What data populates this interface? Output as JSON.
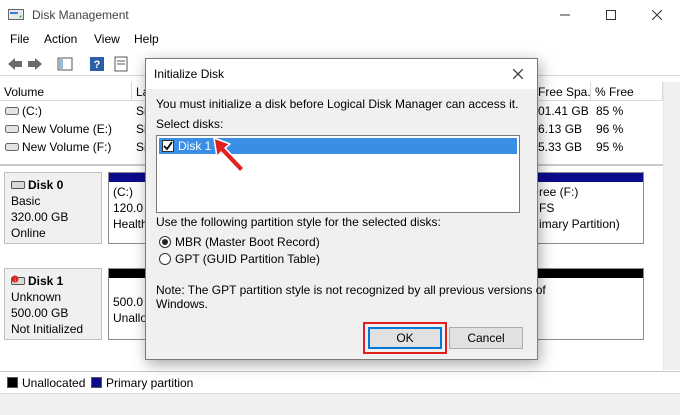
{
  "window": {
    "title": "Disk Management",
    "menus": [
      "File",
      "Action",
      "View",
      "Help"
    ]
  },
  "volume_list": {
    "columns": [
      "Volume",
      "La",
      "Free Spa...",
      "% Free"
    ],
    "rows": [
      {
        "name": "(C:)",
        "type_fragment": "Si",
        "free": "01.41 GB",
        "pct": "85 %"
      },
      {
        "name": "New Volume (E:)",
        "type_fragment": "Si",
        "free": "6.13 GB",
        "pct": "96 %"
      },
      {
        "name": "New Volume (F:)",
        "type_fragment": "Si",
        "free": "5.33 GB",
        "pct": "95 %"
      }
    ]
  },
  "disks": [
    {
      "name": "Disk 0",
      "lines": [
        "Basic",
        "320.00 GB",
        "Online"
      ],
      "part1": [
        "(C:)",
        "120.0",
        "Health"
      ],
      "part_right": [
        "ree  (F:)",
        "FS",
        "imary Partition)"
      ]
    },
    {
      "name": "Disk 1",
      "lines": [
        "Unknown",
        "500.00 GB",
        "Not Initialized"
      ],
      "part1": [
        "500.0",
        "Unallo"
      ]
    }
  ],
  "legend": {
    "unallocated": "Unallocated",
    "primary": "Primary partition"
  },
  "dialog": {
    "title": "Initialize Disk",
    "intro": "You must initialize a disk before Logical Disk Manager can access it.",
    "select_label": "Select disks:",
    "disk_item": "Disk 1",
    "partition_style_label": "Use the following partition style for the selected disks:",
    "mbr_label": "MBR (Master Boot Record)",
    "gpt_label": "GPT (GUID Partition Table)",
    "note_line1": "Note: The GPT partition style is not recognized by all previous versions of",
    "note_line2": "Windows.",
    "ok_label": "OK",
    "cancel_label": "Cancel"
  },
  "colors": {
    "primary_partition": "#0b0b8c",
    "unallocated": "#000000",
    "selection": "#3a8ee6",
    "highlight_box": "#e0201e"
  }
}
